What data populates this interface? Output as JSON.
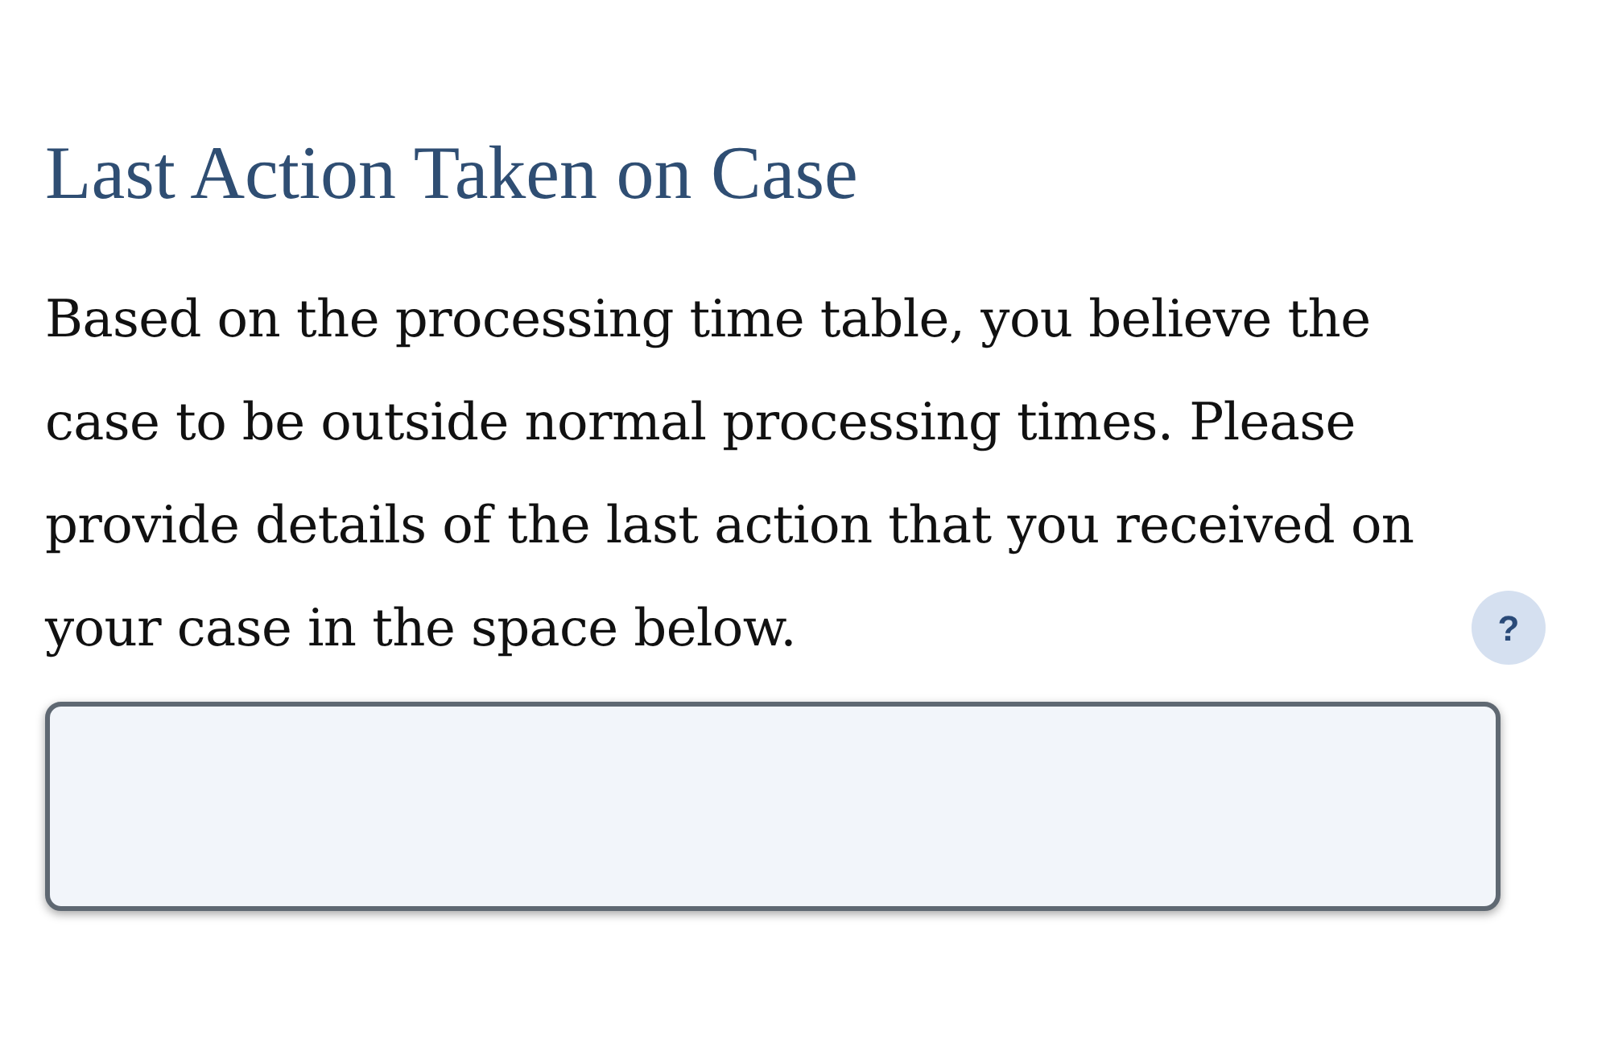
{
  "heading": "Last Action Taken on Case",
  "instructions": "Based on the processing time table, you believe the case to be outside normal processing times. Please provide details of the last action that you received on your case in the space below.",
  "help_button": {
    "label": "?"
  }
}
